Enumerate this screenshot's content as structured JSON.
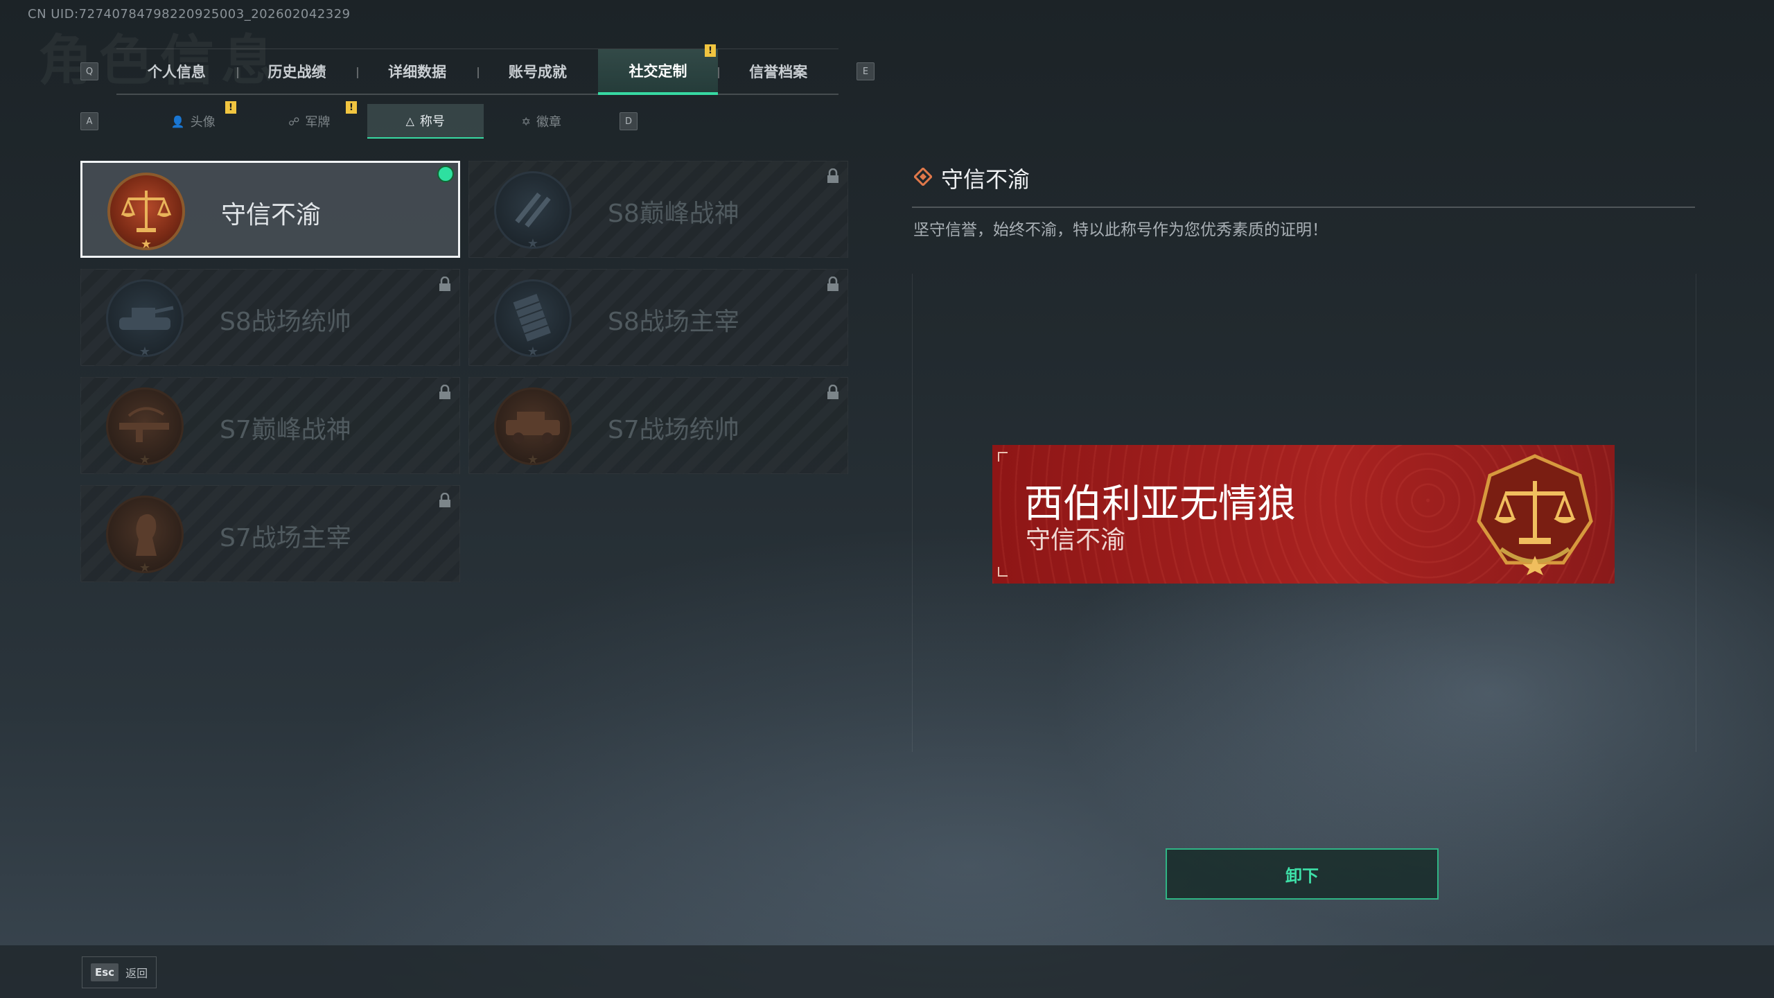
{
  "uid_text": "CN UID:72740784798220925003_202602042329",
  "bg_title": "角色信息",
  "tabs": {
    "left_key": "Q",
    "right_key": "E",
    "items": [
      "个人信息",
      "历史战绩",
      "详细数据",
      "账号成就",
      "社交定制",
      "信誉档案"
    ],
    "active_index": 4,
    "notice_mark": "!"
  },
  "subtabs": {
    "left_key": "A",
    "right_key": "D",
    "items": [
      "头像",
      "军牌",
      "称号",
      "徽章"
    ],
    "active_index": 2,
    "notice_mark": "!"
  },
  "titles": [
    {
      "name": "守信不渝",
      "locked": false,
      "equipped": true
    },
    {
      "name": "S8巅峰战神",
      "locked": true
    },
    {
      "name": "S8战场统帅",
      "locked": true
    },
    {
      "name": "S8战场主宰",
      "locked": true
    },
    {
      "name": "S7巅峰战神",
      "locked": true
    },
    {
      "name": "S7战场统帅",
      "locked": true
    },
    {
      "name": "S7战场主宰",
      "locked": true
    }
  ],
  "detail": {
    "name": "守信不渝",
    "description": "坚守信誉，始终不渝，特以此称号作为您优秀素质的证明！"
  },
  "banner": {
    "player_name": "西伯利亚无情狼",
    "title": "守信不渝"
  },
  "unequip_label": "卸下",
  "footer": {
    "esc_key": "Esc",
    "back_label": "返回"
  },
  "colors": {
    "accent": "#37d9a2",
    "notice": "#f1c540",
    "banner_red": "#a82220"
  }
}
